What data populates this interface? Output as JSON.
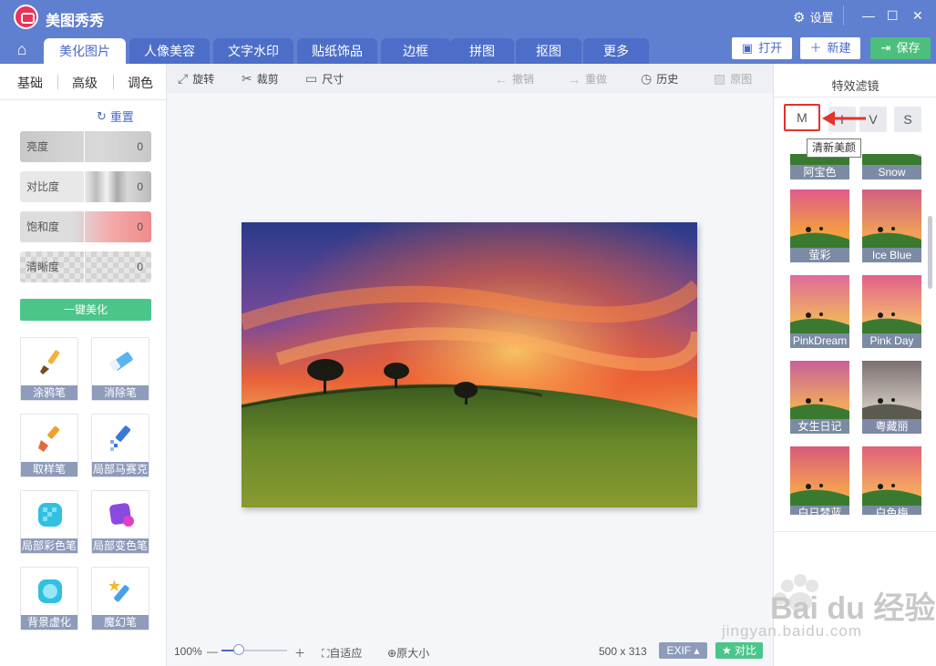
{
  "app": {
    "title": "美图秀秀",
    "settings_label": "设置"
  },
  "tabs": [
    {
      "label": "美化图片",
      "active": true
    },
    {
      "label": "人像美容"
    },
    {
      "label": "文字水印"
    },
    {
      "label": "贴纸饰品"
    },
    {
      "label": "边框"
    },
    {
      "label": "拼图"
    },
    {
      "label": "抠图"
    },
    {
      "label": "更多"
    }
  ],
  "top_actions": {
    "open": "打开",
    "new": "新建",
    "save": "保存"
  },
  "left": {
    "subtabs": [
      "基础",
      "高级",
      "调色"
    ],
    "reset": "重置",
    "adjust": [
      {
        "label": "亮度",
        "value": "0"
      },
      {
        "label": "对比度",
        "value": "0"
      },
      {
        "label": "饱和度",
        "value": "0"
      },
      {
        "label": "清晰度",
        "value": "0"
      }
    ],
    "one_click": "一键美化",
    "tools": [
      "涂鸦笔",
      "消除笔",
      "取样笔",
      "局部马赛克",
      "局部彩色笔",
      "局部变色笔",
      "背景虚化",
      "魔幻笔"
    ]
  },
  "toolbar": {
    "rotate": "旋转",
    "crop": "裁剪",
    "size": "尺寸",
    "undo": "撤销",
    "redo": "重做",
    "history": "历史",
    "original": "原图"
  },
  "status": {
    "zoom": "100%",
    "zoom_fraction": 0.26,
    "fit": "自适应",
    "original_size": "原大小",
    "dimensions": "500 x 313",
    "exif": "EXIF",
    "compare": "对比"
  },
  "right": {
    "title": "特效滤镜",
    "letters": [
      "M",
      "I",
      "V",
      "S"
    ],
    "tooltip": "清新美颜",
    "filters": [
      {
        "label": "阿宝色"
      },
      {
        "label": "Snow"
      },
      {
        "label": "萤彩"
      },
      {
        "label": "Ice Blue"
      },
      {
        "label": "PinkDream"
      },
      {
        "label": "Pink Day"
      },
      {
        "label": "女生日记"
      },
      {
        "label": "粤藏丽"
      },
      {
        "label": "白日梦蓝"
      },
      {
        "label": "白色梅"
      }
    ]
  },
  "watermark": {
    "brand": "Bai du 经验",
    "url": "jingyan.baidu.com"
  },
  "colors": {
    "accent": "#5f7fd0",
    "green": "#4cc58a",
    "highlight": "#e4322c"
  }
}
